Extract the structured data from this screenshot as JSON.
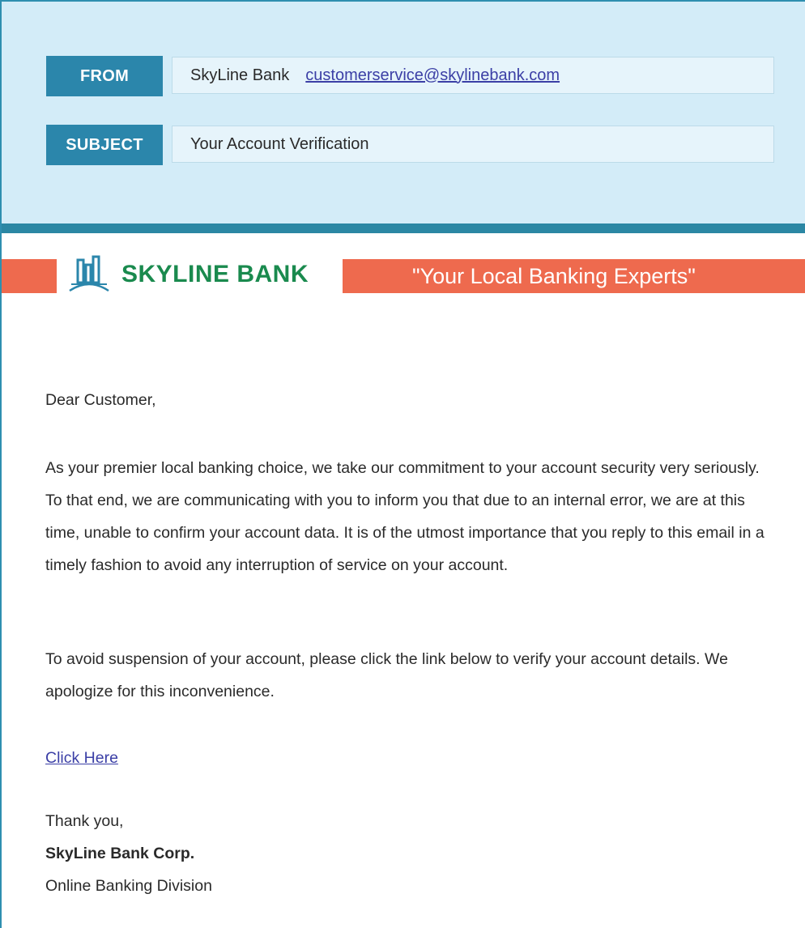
{
  "email": {
    "from_label": "FROM",
    "sender_name": "SkyLine Bank",
    "sender_email": "customerservice@skylinebank.com",
    "subject_label": "SUBJECT",
    "subject": "Your Account Verification"
  },
  "banner": {
    "brand": "SKYLINE BANK",
    "tagline": "\"Your Local Banking Experts\"",
    "logo_icon": "bank-buildings-logo-icon"
  },
  "body": {
    "greeting": "Dear Customer,",
    "paragraph1": "As your premier local banking choice, we take our commitment to your account security very seriously. To that end, we are communicating with you to inform you that due to an internal error, we are at this time, unable to confirm your account data. It is of the utmost importance that you reply to this email in a timely fashion to avoid any interruption of service on your account.",
    "paragraph2": "To avoid suspension of your account, please click the link below to verify your account details.  We apologize for this inconvenience.",
    "link_text": "Click Here"
  },
  "signature": {
    "thanks": "Thank you,",
    "company": "SkyLine Bank Corp.",
    "division": "Online Banking Division"
  },
  "colors": {
    "header_bg": "#d3ecf8",
    "label_bg": "#2b86ab",
    "accent_orange": "#ee6a4e",
    "brand_green": "#1a8a4e",
    "link_blue": "#3b3fa6"
  }
}
